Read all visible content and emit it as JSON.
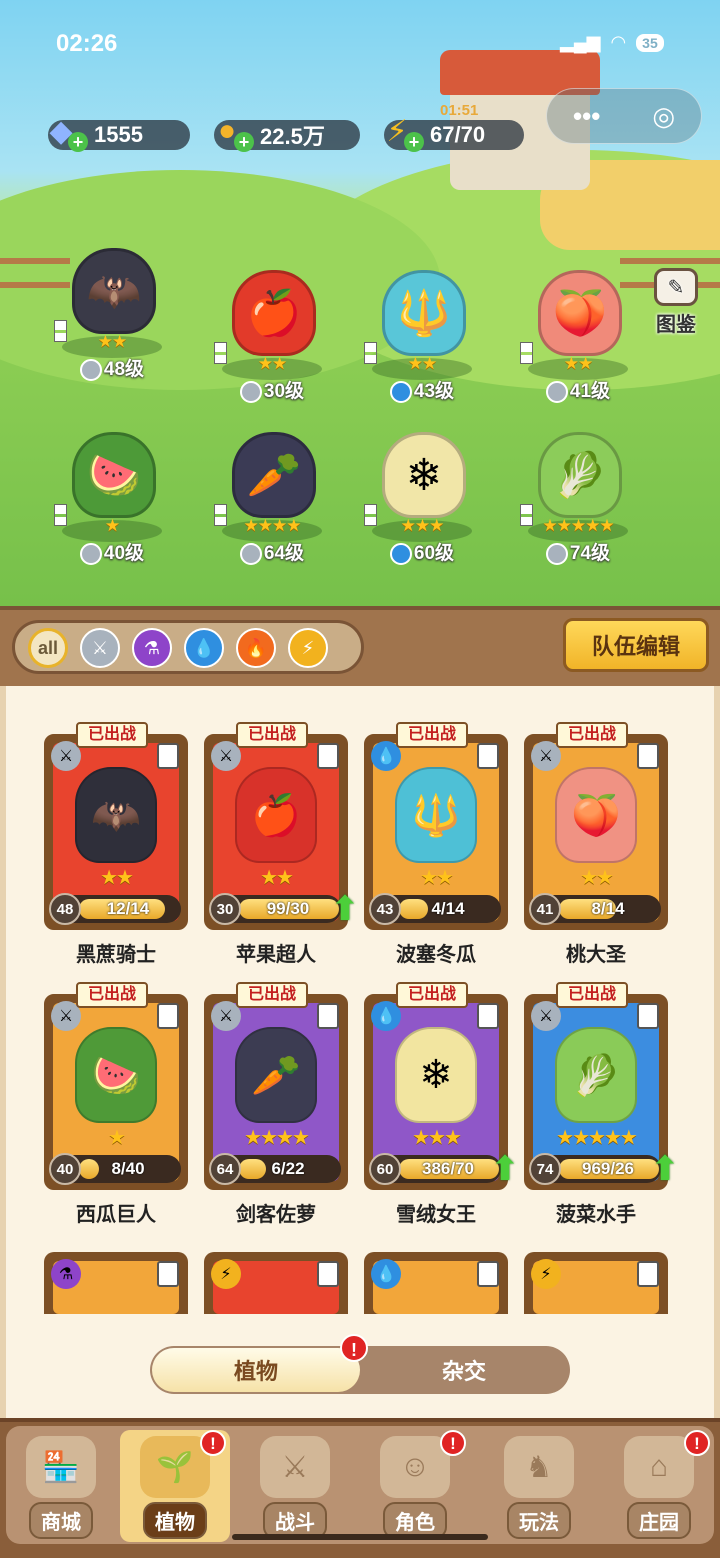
{
  "status": {
    "time": "02:26",
    "battery": "35"
  },
  "resources": {
    "gems": "1555",
    "gold": "22.5万",
    "energy": "67/70",
    "energy_timer": "01:51"
  },
  "codex_label": "图鉴",
  "team": [
    {
      "level": "48级",
      "stars": "★★",
      "element": "sword",
      "emoji": "🦇",
      "color": "#3a3a48"
    },
    {
      "level": "30级",
      "stars": "★★",
      "element": "sword",
      "emoji": "🍎",
      "color": "#e23a2a"
    },
    {
      "level": "43级",
      "stars": "★★",
      "element": "water",
      "emoji": "🔱",
      "color": "#59c6d8"
    },
    {
      "level": "41级",
      "stars": "★★",
      "element": "sword",
      "emoji": "🍑",
      "color": "#f08a7a"
    },
    {
      "level": "40级",
      "stars": "★",
      "element": "sword",
      "emoji": "🍉",
      "color": "#4d9a38"
    },
    {
      "level": "64级",
      "stars": "★★★★",
      "element": "sword",
      "emoji": "🥕",
      "color": "#3b3b55"
    },
    {
      "level": "60级",
      "stars": "★★★",
      "element": "water",
      "emoji": "❄",
      "color": "#f1e6a8"
    },
    {
      "level": "74级",
      "stars": "★★★★★",
      "element": "sword",
      "emoji": "🥬",
      "color": "#8ccc5a"
    }
  ],
  "filters": [
    "all",
    "sword",
    "poison",
    "water",
    "fire",
    "lightning"
  ],
  "team_edit_label": "队伍编辑",
  "deployed_label": "已出战",
  "cards": [
    {
      "name": "黑蔗骑士",
      "level": "48",
      "progress": "12/14",
      "stars": "★★",
      "element": "sword",
      "emoji": "🦇",
      "bg": "#e8442e",
      "portrait": "#2f2f3a",
      "fill": 0.86,
      "upgrade": false
    },
    {
      "name": "苹果超人",
      "level": "30",
      "progress": "99/30",
      "stars": "★★",
      "element": "sword",
      "emoji": "🍎",
      "bg": "#e8442e",
      "portrait": "#d8322a",
      "fill": 1.0,
      "upgrade": true
    },
    {
      "name": "波塞冬瓜",
      "level": "43",
      "progress": "4/14",
      "stars": "★★",
      "element": "water",
      "emoji": "🔱",
      "bg": "#f2a63a",
      "portrait": "#4ec0d6",
      "fill": 0.29,
      "upgrade": false
    },
    {
      "name": "桃大圣",
      "level": "41",
      "progress": "8/14",
      "stars": "★★",
      "element": "sword",
      "emoji": "🍑",
      "bg": "#f2a63a",
      "portrait": "#f09283",
      "fill": 0.57,
      "upgrade": false
    },
    {
      "name": "西瓜巨人",
      "level": "40",
      "progress": "8/40",
      "stars": "★",
      "element": "sword",
      "emoji": "🍉",
      "bg": "#f2a63a",
      "portrait": "#4f9a38",
      "fill": 0.2,
      "upgrade": false
    },
    {
      "name": "剑客佐萝",
      "level": "64",
      "progress": "6/22",
      "stars": "★★★★",
      "element": "sword",
      "emoji": "🥕",
      "bg": "#8f57c8",
      "portrait": "#3c3c52",
      "fill": 0.27,
      "upgrade": false
    },
    {
      "name": "雪绒女王",
      "level": "60",
      "progress": "386/70",
      "stars": "★★★",
      "element": "water",
      "emoji": "❄",
      "bg": "#8f57c8",
      "portrait": "#f2e5a0",
      "fill": 1.0,
      "upgrade": true
    },
    {
      "name": "菠菜水手",
      "level": "74",
      "progress": "969/26",
      "stars": "★★★★★",
      "element": "sword",
      "emoji": "🥬",
      "bg": "#3c8de0",
      "portrait": "#8acb58",
      "fill": 1.0,
      "upgrade": true
    }
  ],
  "partial_cards": [
    {
      "element": "poison",
      "bg": "#f2a63a"
    },
    {
      "element": "lightning",
      "bg": "#e8442e"
    },
    {
      "element": "water",
      "bg": "#f2a63a"
    },
    {
      "element": "lightning",
      "bg": "#f2a63a"
    }
  ],
  "toggle": {
    "active": "植物",
    "other": "杂交",
    "badge": "!"
  },
  "nav": [
    {
      "label": "商城",
      "icon": "shop-icon",
      "glyph": "🏪",
      "active": false,
      "badge": false
    },
    {
      "label": "植物",
      "icon": "plants-icon",
      "glyph": "🌱",
      "active": true,
      "badge": true
    },
    {
      "label": "战斗",
      "icon": "battle-icon",
      "glyph": "⚔",
      "active": false,
      "badge": false
    },
    {
      "label": "角色",
      "icon": "character-icon",
      "glyph": "☺",
      "active": false,
      "badge": true
    },
    {
      "label": "玩法",
      "icon": "gameplay-icon",
      "glyph": "♞",
      "active": false,
      "badge": false
    },
    {
      "label": "庄园",
      "icon": "manor-icon",
      "glyph": "⌂",
      "active": false,
      "badge": true
    }
  ],
  "colors": {
    "sword": "#a8b2bd",
    "water": "#2f8fe0",
    "poison": "#8e44c9",
    "fire": "#f26a1e",
    "lightning": "#f2b21e",
    "all": "#f3e6c2"
  }
}
